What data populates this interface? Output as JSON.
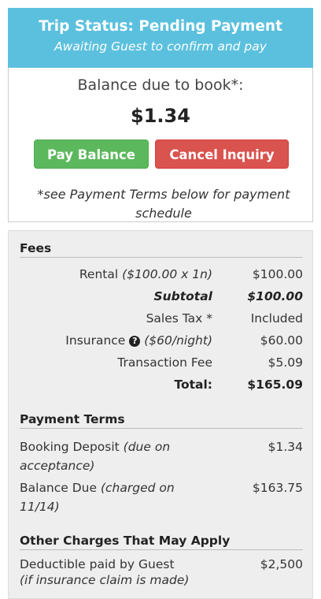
{
  "status": {
    "title": "Trip Status: Pending Payment",
    "subtitle": "Awaiting Guest to confirm and pay"
  },
  "balance": {
    "label": "Balance due to book*:",
    "amount": "$1.34",
    "pay_button": "Pay Balance",
    "cancel_button": "Cancel Inquiry",
    "note": "*see Payment Terms below for payment schedule"
  },
  "fees": {
    "title": "Fees",
    "rental_label": "Rental",
    "rental_detail": "($100.00 x 1n)",
    "rental_value": "$100.00",
    "subtotal_label": "Subtotal",
    "subtotal_value": "$100.00",
    "sales_tax_label": "Sales Tax *",
    "sales_tax_value": "Included",
    "insurance_label": "Insurance",
    "insurance_detail": "($60/night)",
    "insurance_value": "$60.00",
    "transaction_label": "Transaction Fee",
    "transaction_value": "$5.09",
    "total_label": "Total:",
    "total_value": "$165.09"
  },
  "payment_terms": {
    "title": "Payment Terms",
    "deposit_label": "Booking Deposit",
    "deposit_detail": "(due on acceptance)",
    "deposit_value": "$1.34",
    "balance_label": "Balance Due",
    "balance_detail": "(charged on 11/14)",
    "balance_value": "$163.75"
  },
  "other_charges": {
    "title": "Other Charges That May Apply",
    "deductible_label": "Deductible paid by Guest",
    "deductible_detail": "(if insurance claim is made)",
    "deductible_value": "$2,500"
  },
  "icons": {
    "insurance_help": "question-circle-icon"
  },
  "colors": {
    "header": "#5bc0de",
    "pay": "#5cb85c",
    "cancel": "#d9534f"
  }
}
